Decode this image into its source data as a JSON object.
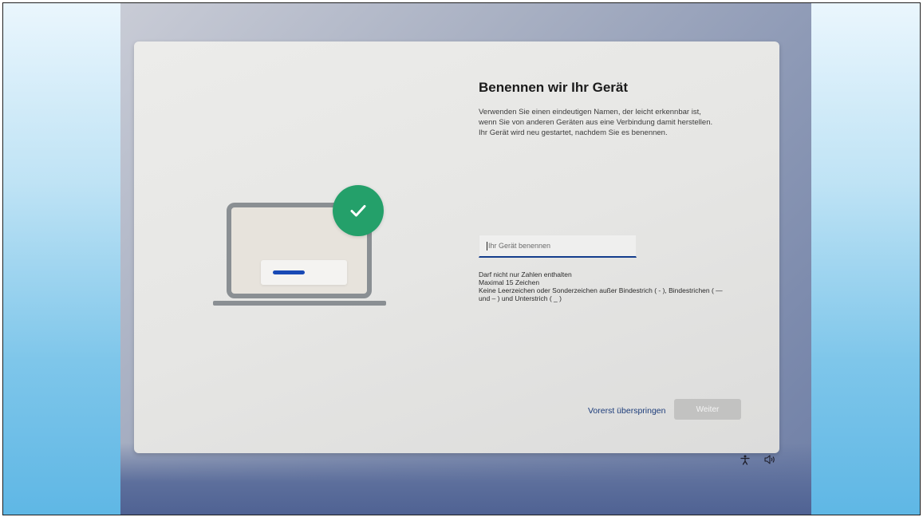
{
  "dialog": {
    "title": "Benennen wir Ihr Gerät",
    "description_lines": [
      "Verwenden Sie einen eindeutigen Namen, der leicht erkennbar ist,",
      "wenn Sie von anderen Geräten aus eine Verbindung damit herstellen.",
      "Ihr Gerät wird neu gestartet, nachdem Sie es benennen."
    ],
    "input": {
      "placeholder": "Ihr Gerät benennen",
      "value": ""
    },
    "rules": [
      "Darf nicht nur Zahlen enthalten",
      "Maximal 15 Zeichen",
      "Keine Leerzeichen oder Sonderzeichen außer Bindestrich ( - ), Bindestrichen ( —",
      "und – ) und Unterstrich ( _ )"
    ],
    "skip_label": "Vorerst überspringen",
    "next_label": "Weiter"
  },
  "illustration": {
    "icons": [
      "laptop-icon",
      "checkmark-icon"
    ]
  },
  "tray": {
    "icons": [
      "accessibility-icon",
      "speaker-icon"
    ]
  },
  "colors": {
    "accent_blue": "#143d8c",
    "check_green": "#24a06a",
    "link_blue": "#1c3c7a",
    "button_disabled": "#c2c2c1"
  }
}
